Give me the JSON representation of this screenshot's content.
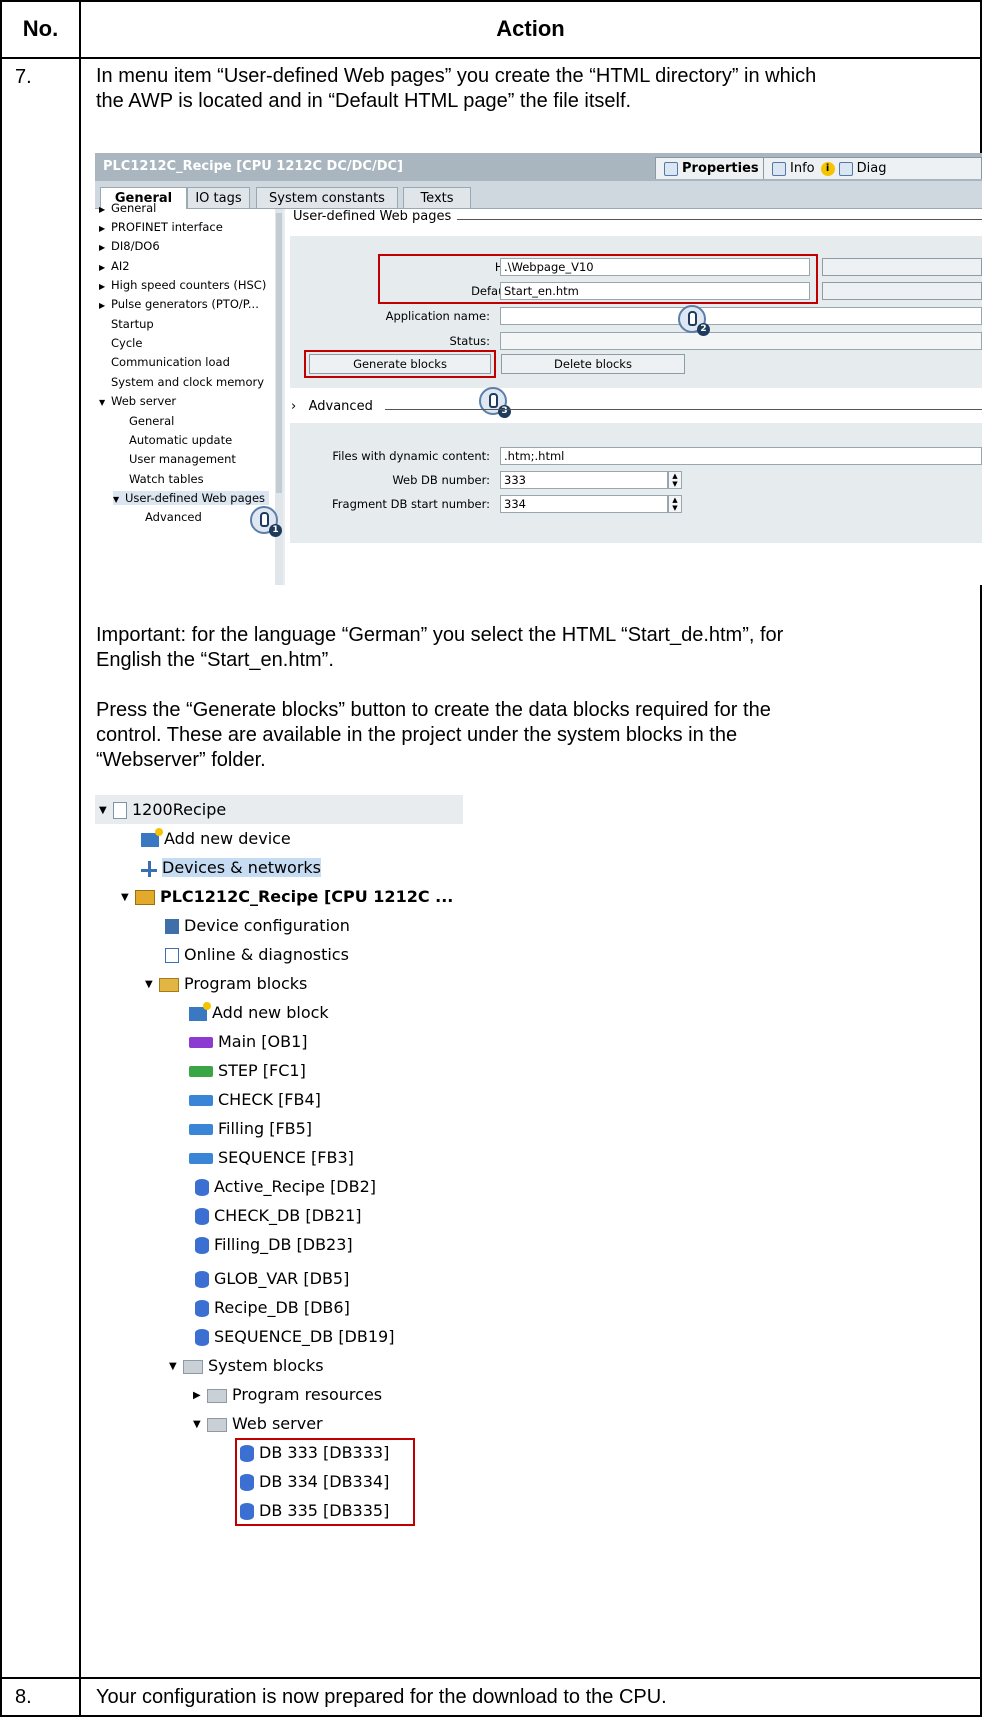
{
  "table": {
    "col_no": "No.",
    "col_action": "Action",
    "row7_no": "7.",
    "row8_no": "8."
  },
  "row7": {
    "intro_line1": "In menu item “User-defined Web pages” you create the “HTML directory” in which",
    "intro_line2": "the AWP is located and in “Default HTML page” the file itself.",
    "important_line1": "Important: for the language “German” you select the HTML “Start_de.htm”, for",
    "important_line2": "English the “Start_en.htm”.",
    "press_line1": "Press the “Generate blocks” button to create the data blocks required for the",
    "press_line2": "control. These are available in the project under the system blocks in the",
    "press_line3": "“Webserver” folder."
  },
  "row8": {
    "text": "Your configuration is now prepared for the download to the CPU."
  },
  "tia": {
    "window_title": "PLC1212C_Recipe [CPU 1212C DC/DC/DC]",
    "properties_tab": "Properties",
    "info_tab": "Info",
    "diag_tab": "Diag",
    "tabs": [
      "General",
      "IO tags",
      "System constants",
      "Texts"
    ],
    "nav": [
      "General",
      "PROFINET interface",
      "DI8/DO6",
      "AI2",
      "High speed counters (HSC)",
      "Pulse generators (PTO/P...",
      "Startup",
      "Cycle",
      "Communication load",
      "System and clock memory",
      "Web server",
      "General",
      "Automatic update",
      "User management",
      "Watch tables",
      "User-defined Web pages",
      "Advanced"
    ],
    "section_title": "User-defined Web pages",
    "html_dir_label": "HTML directory:",
    "html_dir_value": ".\\Webpage_V10",
    "default_page_label": "Default HTML page:",
    "default_page_value": "Start_en.htm",
    "app_name_label": "Application name:",
    "status_label": "Status:",
    "generate_btn": "Generate blocks",
    "delete_btn": "Delete blocks",
    "advanced_title": "Advanced",
    "dyn_content_label": "Files with dynamic content:",
    "dyn_content_value": ".htm;.html",
    "web_db_label": "Web DB number:",
    "web_db_value": "333",
    "frag_db_label": "Fragment DB start number:",
    "frag_db_value": "334",
    "callouts": [
      "1",
      "2",
      "3"
    ]
  },
  "tree": {
    "items": [
      "1200Recipe",
      "Add new device",
      "Devices & networks",
      "PLC1212C_Recipe [CPU 1212C ...",
      "Device configuration",
      "Online & diagnostics",
      "Program blocks",
      "Add new block",
      "Main [OB1]",
      "STEP [FC1]",
      "CHECK [FB4]",
      "Filling [FB5]",
      "SEQUENCE [FB3]",
      "Active_Recipe [DB2]",
      "CHECK_DB [DB21]",
      "Filling_DB [DB23]",
      "GLOB_VAR [DB5]",
      "Recipe_DB [DB6]",
      "SEQUENCE_DB [DB19]",
      "System blocks",
      "Program resources",
      "Web server",
      "DB 333 [DB333]",
      "DB 334 [DB334]",
      "DB 335 [DB335]"
    ]
  },
  "colors": {
    "highlight_box": "#c00000",
    "tia_title_bar": "#a9b6bf"
  }
}
